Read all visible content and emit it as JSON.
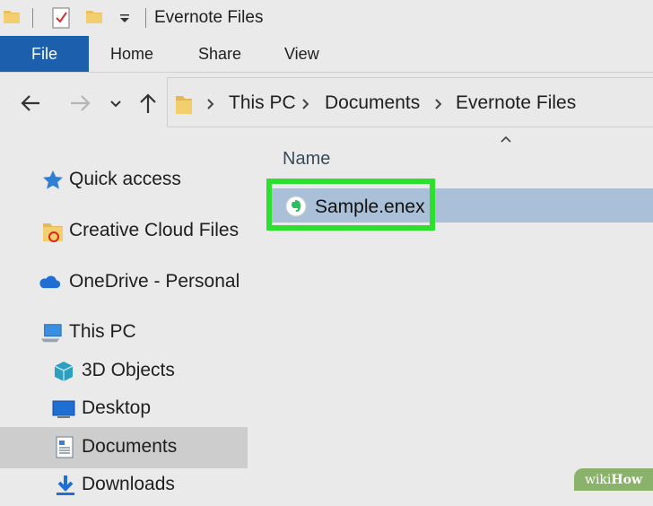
{
  "window": {
    "title": "Evernote Files"
  },
  "ribbon": {
    "file_tab": "File",
    "tabs": [
      "Home",
      "Share",
      "View"
    ]
  },
  "breadcrumb": [
    "This PC",
    "Documents",
    "Evernote Files"
  ],
  "file_list": {
    "column_name": "Name",
    "items": [
      {
        "name": "Sample.enex",
        "icon": "evernote-icon",
        "selected": true
      }
    ]
  },
  "nav_pane": {
    "items": [
      {
        "label": "Quick access",
        "icon": "star-icon"
      },
      {
        "label": "Creative Cloud Files",
        "icon": "creative-cloud-folder-icon"
      },
      {
        "label": "OneDrive - Personal",
        "icon": "cloud-icon"
      },
      {
        "label": "This PC",
        "icon": "computer-icon"
      },
      {
        "label": "3D Objects",
        "icon": "cube-icon"
      },
      {
        "label": "Desktop",
        "icon": "desktop-icon"
      },
      {
        "label": "Documents",
        "icon": "documents-icon",
        "selected": true
      },
      {
        "label": "Downloads",
        "icon": "download-icon"
      }
    ]
  },
  "watermark": {
    "prefix": "wiki",
    "suffix": "How"
  },
  "colors": {
    "file_tab": "#1b5fad",
    "selection": "#aabfd8",
    "highlight": "#2ee02e",
    "nav_selected": "#cdcdcd"
  }
}
